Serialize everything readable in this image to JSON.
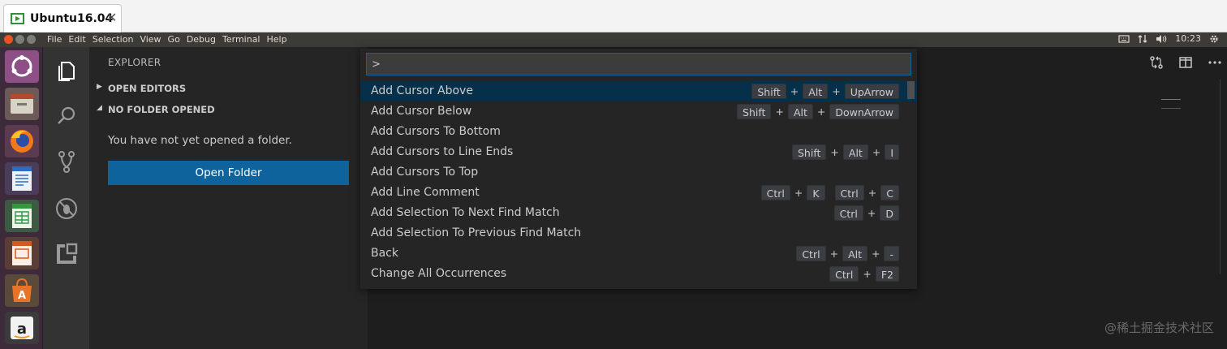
{
  "host_tab": {
    "title": "Ubuntu16.04",
    "close": "✕"
  },
  "top_panel": {
    "menus": [
      "File",
      "Edit",
      "Selection",
      "View",
      "Go",
      "Debug",
      "Terminal",
      "Help"
    ],
    "time": "10:23",
    "button_colors": [
      "#e95420",
      "#7c7c78",
      "#7c7c78"
    ]
  },
  "launcher": {
    "items": [
      "ubuntu-dash-icon",
      "files-icon",
      "firefox-icon",
      "writer-icon",
      "calc-icon",
      "impress-icon",
      "software-center-icon",
      "amazon-icon"
    ]
  },
  "activity_bar": {
    "items": [
      "explorer-icon",
      "search-icon",
      "source-control-icon",
      "debug-icon",
      "extensions-icon"
    ]
  },
  "sidebar": {
    "title": "EXPLORER",
    "sections": [
      {
        "label": "OPEN EDITORS",
        "expanded": false
      },
      {
        "label": "NO FOLDER OPENED",
        "expanded": true
      }
    ],
    "message": "You have not yet opened a folder.",
    "open_folder_label": "Open Folder"
  },
  "palette": {
    "input_value": ">",
    "items": [
      {
        "label": "Add Cursor Above",
        "selected": true,
        "chords": [
          [
            "Shift",
            "Alt",
            "UpArrow"
          ]
        ]
      },
      {
        "label": "Add Cursor Below",
        "chords": [
          [
            "Shift",
            "Alt",
            "DownArrow"
          ]
        ]
      },
      {
        "label": "Add Cursors To Bottom",
        "chords": []
      },
      {
        "label": "Add Cursors to Line Ends",
        "chords": [
          [
            "Shift",
            "Alt",
            "I"
          ]
        ]
      },
      {
        "label": "Add Cursors To Top",
        "chords": []
      },
      {
        "label": "Add Line Comment",
        "chords": [
          [
            "Ctrl",
            "K"
          ],
          [
            "Ctrl",
            "C"
          ]
        ]
      },
      {
        "label": "Add Selection To Next Find Match",
        "chords": [
          [
            "Ctrl",
            "D"
          ]
        ]
      },
      {
        "label": "Add Selection To Previous Find Match",
        "chords": []
      },
      {
        "label": "Back",
        "chords": [
          [
            "Ctrl",
            "Alt",
            "-"
          ]
        ]
      },
      {
        "label": "Change All Occurrences",
        "chords": [
          [
            "Ctrl",
            "F2"
          ]
        ]
      }
    ]
  },
  "watermark": "@稀土掘金技术社区",
  "colors": {
    "selection": "#062f4a",
    "button": "#0e639c",
    "sidebar": "#252526",
    "activity": "#333333"
  }
}
